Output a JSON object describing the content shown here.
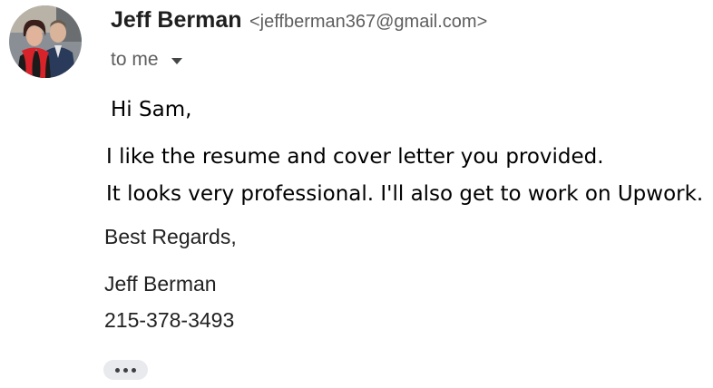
{
  "sender": {
    "name": "Jeff Berman",
    "email": "<jeffberman367@gmail.com>"
  },
  "recipient": {
    "label": "to me"
  },
  "message": {
    "greeting": "Hi Sam,",
    "lines": [
      "I like the resume and cover letter you provided.",
      "It looks very professional. I'll also get to work on Upwork."
    ],
    "closing": "Best Regards,",
    "signature_name": "Jeff Berman",
    "signature_phone": "215-378-3493"
  },
  "icons": {
    "recipient_toggle": "caret-down-icon",
    "trimmed_content": "more-horizontal-icon"
  }
}
